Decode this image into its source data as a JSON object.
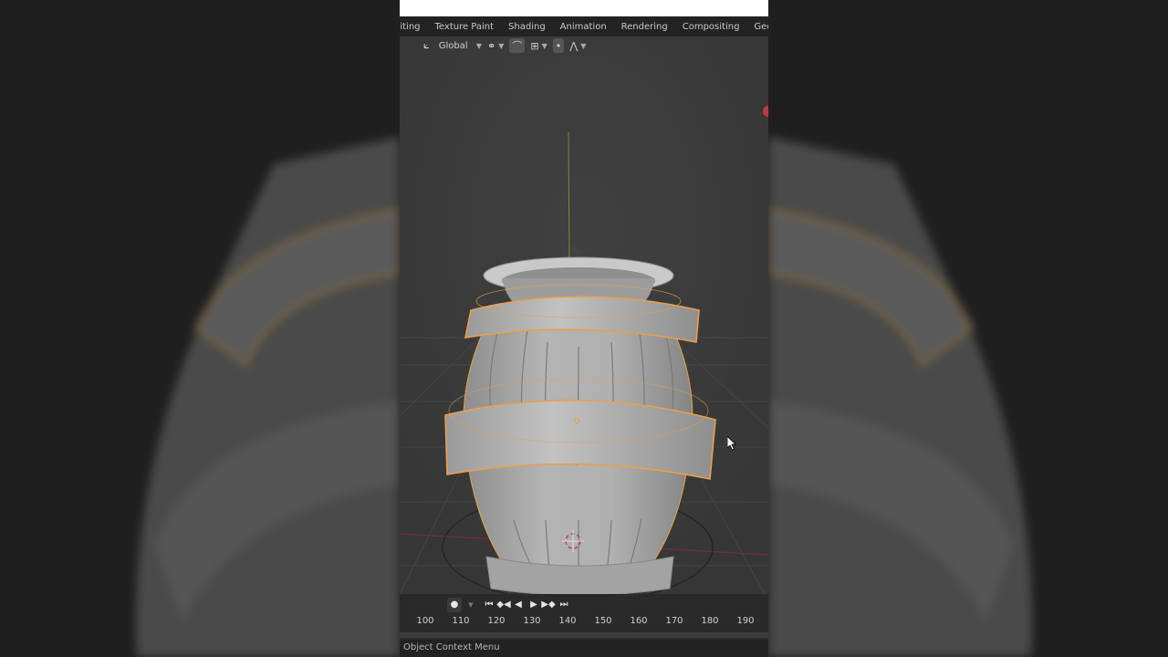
{
  "workspace_tabs": [
    "diting",
    "Texture Paint",
    "Shading",
    "Animation",
    "Rendering",
    "Compositing",
    "Geometry No"
  ],
  "header": {
    "orientation_label": "Global",
    "icons": [
      "transform-orientation-icon",
      "link-icon",
      "snap-icon",
      "snap-increment-icon",
      "proportional-editing-icon",
      "falloff-curve-icon"
    ]
  },
  "timeline": {
    "frame_ticks": [
      "100",
      "110",
      "120",
      "130",
      "140",
      "150",
      "160",
      "170",
      "180",
      "190"
    ],
    "controls": [
      "record-icon",
      "jump-start-icon",
      "prev-keyframe-icon",
      "play-reverse-icon",
      "play-icon",
      "next-keyframe-icon",
      "jump-end-icon"
    ]
  },
  "statusbar": {
    "text": "Object Context Menu"
  },
  "colors": {
    "viewport_bg": "#3b3b3b",
    "selection_outline": "#e8a04a",
    "x_axis": "#8a2a3a",
    "z_axis": "#7a8a3a",
    "barrel": "#a9a9a9"
  }
}
